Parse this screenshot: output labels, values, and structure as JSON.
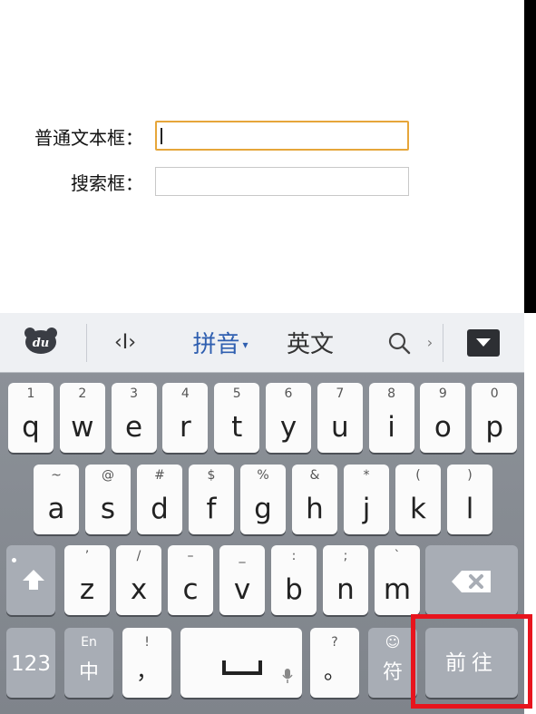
{
  "form": {
    "normal_label": "普通文本框：",
    "normal_value": "",
    "search_label": "搜索框：",
    "search_value": ""
  },
  "candidate_bar": {
    "logo_text": "du",
    "cursor_icon": "‹I›",
    "pinyin_label": "拼音",
    "pinyin_arrow": "▾",
    "english_label": "英文",
    "more_arrow": "›"
  },
  "keys": {
    "row1": [
      {
        "main": "q",
        "sub": "1"
      },
      {
        "main": "w",
        "sub": "2"
      },
      {
        "main": "e",
        "sub": "3"
      },
      {
        "main": "r",
        "sub": "4"
      },
      {
        "main": "t",
        "sub": "5"
      },
      {
        "main": "y",
        "sub": "6"
      },
      {
        "main": "u",
        "sub": "7"
      },
      {
        "main": "i",
        "sub": "8"
      },
      {
        "main": "o",
        "sub": "9"
      },
      {
        "main": "p",
        "sub": "0"
      }
    ],
    "row2": [
      {
        "main": "a",
        "sub": "~"
      },
      {
        "main": "s",
        "sub": "@"
      },
      {
        "main": "d",
        "sub": "#"
      },
      {
        "main": "f",
        "sub": "$"
      },
      {
        "main": "g",
        "sub": "%"
      },
      {
        "main": "h",
        "sub": "&"
      },
      {
        "main": "j",
        "sub": "*"
      },
      {
        "main": "k",
        "sub": "("
      },
      {
        "main": "l",
        "sub": ")"
      }
    ],
    "row3": [
      {
        "main": "z",
        "sub": "’"
      },
      {
        "main": "x",
        "sub": "/"
      },
      {
        "main": "c",
        "sub": "–"
      },
      {
        "main": "v",
        "sub": "_"
      },
      {
        "main": "b",
        "sub": ":"
      },
      {
        "main": "n",
        "sub": ";"
      },
      {
        "main": "m",
        "sub": "`"
      }
    ],
    "num_label": "123",
    "lang_sub": "En",
    "lang_main": "中",
    "comma_sub": "!",
    "comma_main": "，",
    "period_sub": "?",
    "period_main": "。",
    "symbol_sub": "☺",
    "symbol_main": "符",
    "go_label": "前往"
  }
}
